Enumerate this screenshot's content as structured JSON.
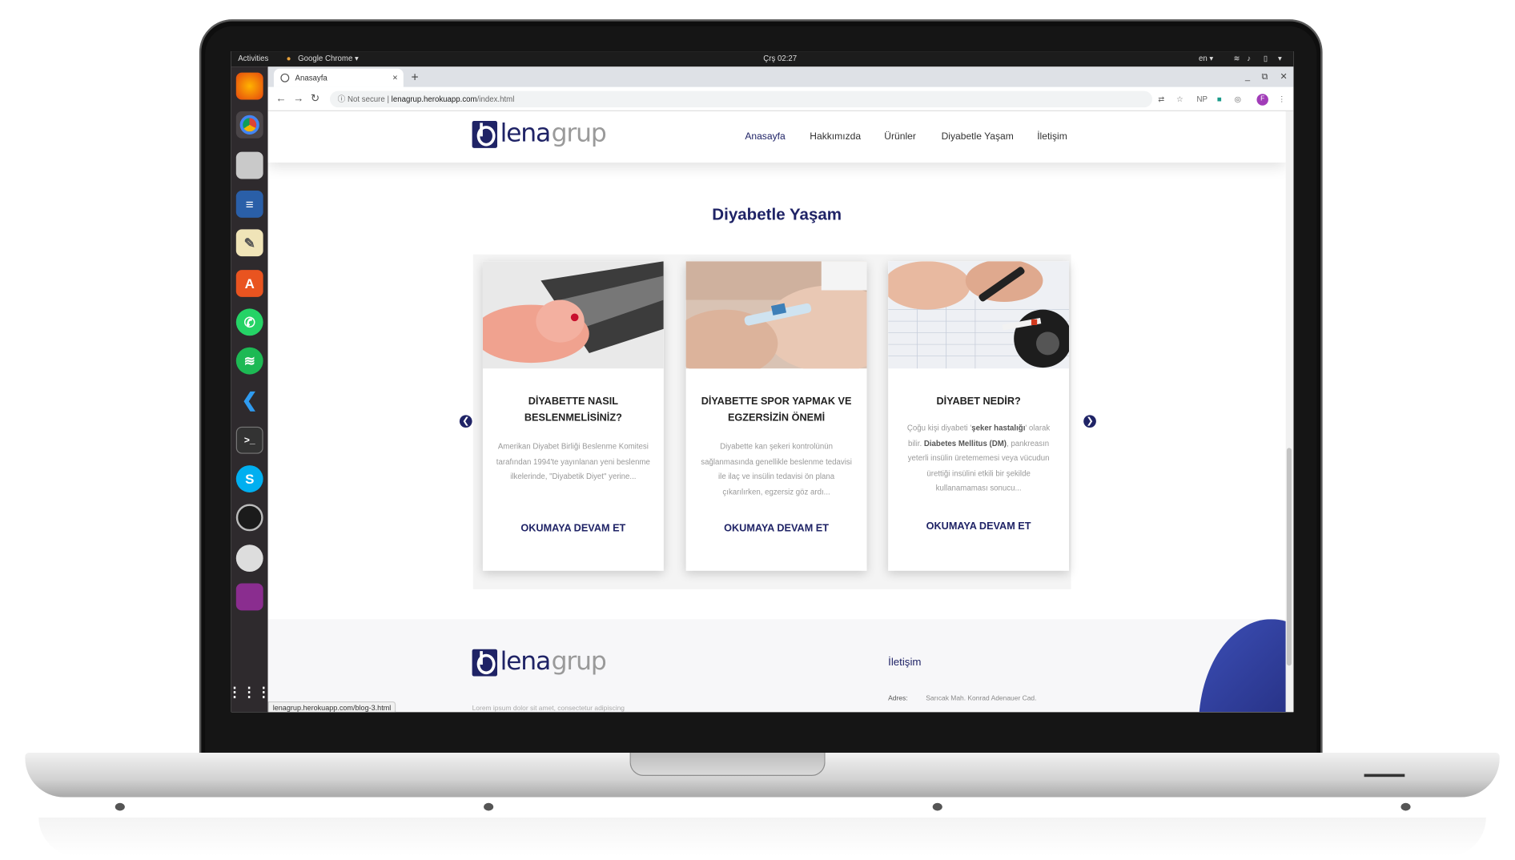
{
  "os": {
    "activities": "Activities",
    "app_menu": "Google Chrome ▾",
    "clock": "Çrş 02:27",
    "lang": "en ▾"
  },
  "browser": {
    "tab_title": "Anasayfa",
    "tab_close": "×",
    "new_tab": "+",
    "security": "Not secure",
    "url_host": "lenagrup.herokuapp.com",
    "url_path": "/index.html",
    "status_url": "lenagrup.herokuapp.com/blog-3.html"
  },
  "site": {
    "logo_lena": "lena",
    "logo_grup": "grup",
    "nav": [
      "Anasayfa",
      "Hakkımızda",
      "Ürünler",
      "Diyabetle Yaşam",
      "İletişim"
    ],
    "section_title": "Diyabetle Yaşam",
    "read_more": "OKUMAYA DEVAM ET",
    "cards": [
      {
        "title": "DİYABETTE NASIL BESLENMELİSİNİZ?",
        "text": "Amerikan Diyabet Birliği Beslenme Komitesi tarafından 1994'te yayınlanan yeni beslenme ilkelerinde, \"Diyabetik Diyet\" yerine..."
      },
      {
        "title": "DİYABETTE SPOR YAPMAK VE EGZERSİZİN ÖNEMİ",
        "text": "Diyabette kan şekeri kontrolünün sağlanmasında genellikle beslenme tedavisi ile ilaç ve insülin tedavisi ön plana çıkarılırken, egzersiz göz ardı..."
      },
      {
        "title": "DİYABET NEDİR?",
        "text_parts": [
          "Çoğu kişi diyabeti '",
          "şeker hastalığı",
          "' olarak bilir. ",
          "Diabetes Mellitus (DM)",
          ", pankreasın yeterli insülin üretememesi veya vücudun ürettiği insülini etkili bir şekilde kullanamaması sonucu..."
        ]
      }
    ],
    "footer": {
      "contact_heading": "İletişim",
      "address_label": "Adres:",
      "address_value": "Sarıcak Mah. Konrad Adenauer Cad.",
      "lorem": "Lorem ipsum dolor sit amet, consectetur adipiscing"
    }
  },
  "colors": {
    "brand": "#1f2366",
    "dock": "#2e2a2d",
    "topbar": "#1c1c1c"
  }
}
